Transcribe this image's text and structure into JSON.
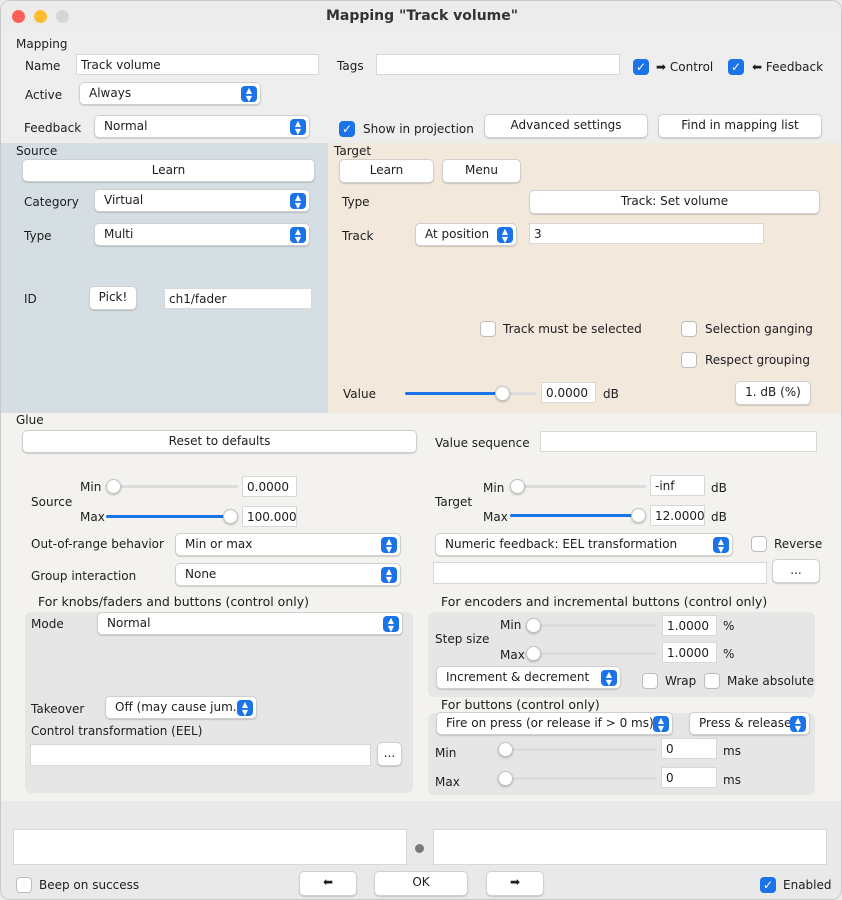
{
  "window": {
    "title": "Mapping \"Track volume\""
  },
  "mapping": {
    "section": "Mapping",
    "name_label": "Name",
    "name_value": "Track volume",
    "tags_label": "Tags",
    "tags_value": "",
    "control_label": "➡ Control",
    "feedback_label": "⬅ Feedback",
    "active_label": "Active",
    "active_value": "Always",
    "feedback_row_label": "Feedback",
    "feedback_value": "Normal",
    "show_in_projection": "Show in projection",
    "advanced_settings": "Advanced settings",
    "find_in_mapping_list": "Find in mapping list"
  },
  "source": {
    "section": "Source",
    "learn": "Learn",
    "category_label": "Category",
    "category_value": "Virtual",
    "type_label": "Type",
    "type_value": "Multi",
    "id_label": "ID",
    "pick": "Pick!",
    "id_value": "ch1/fader"
  },
  "target": {
    "section": "Target",
    "learn": "Learn",
    "menu": "Menu",
    "type_label": "Type",
    "type_value": "Track: Set volume",
    "track_label": "Track",
    "track_mode": "At position",
    "track_value": "3",
    "track_must_be_selected": "Track must be selected",
    "selection_ganging": "Selection ganging",
    "respect_grouping": "Respect grouping",
    "value_label": "Value",
    "value_field": "0.0000",
    "value_unit": "dB",
    "value_button": "1. dB (%)",
    "value_slider": 0.78
  },
  "glue": {
    "section": "Glue",
    "reset": "Reset to defaults",
    "value_sequence_label": "Value sequence",
    "value_sequence": "",
    "source_label": "Source",
    "min_label": "Min",
    "max_label": "Max",
    "source_min": "0.0000",
    "source_max": "100.0000",
    "source_min_slider": 0.0,
    "source_max_slider": 1.0,
    "target_label": "Target",
    "target_min": "-inf",
    "target_max": "12.0000",
    "target_unit": "dB",
    "target_min_slider": 0.0,
    "target_max_slider": 1.0,
    "oor_label": "Out-of-range behavior",
    "oor_value": "Min or max",
    "group_label": "Group interaction",
    "group_value": "None",
    "feedback_type": "Numeric feedback: EEL transformation",
    "reverse": "Reverse",
    "feedback_expr": "",
    "more_button": "...",
    "knobs_header": "For knobs/faders and buttons (control only)",
    "mode_label": "Mode",
    "mode_value": "Normal",
    "takeover_label": "Takeover",
    "takeover_value": "Off (may cause jum...",
    "control_transform_label": "Control transformation (EEL)",
    "control_transform": "",
    "encoders_header": "For encoders and incremental buttons (control only)",
    "step_size_label": "Step size",
    "step_min_label": "Min",
    "step_max_label": "Max",
    "step_min": "1.0000",
    "step_max": "1.0000",
    "step_unit": "%",
    "increment_mode": "Increment & decrement",
    "wrap": "Wrap",
    "make_absolute": "Make absolute",
    "buttons_header": "For buttons (control only)",
    "fire_mode": "Fire on press (or release if > 0 ms)",
    "press_mode": "Press & release",
    "btn_min_label": "Min",
    "btn_max_label": "Max",
    "btn_min": "0",
    "btn_max": "0",
    "ms_unit": "ms"
  },
  "footer": {
    "beep_on_success": "Beep on success",
    "prev": "⬅",
    "ok": "OK",
    "next": "➡",
    "enabled": "Enabled"
  },
  "colors": {
    "accent": "#1a73e8",
    "source_bg": "#d5dfe3",
    "target_bg": "#f3e8dc",
    "glue_bg": "#f3f2ee"
  }
}
